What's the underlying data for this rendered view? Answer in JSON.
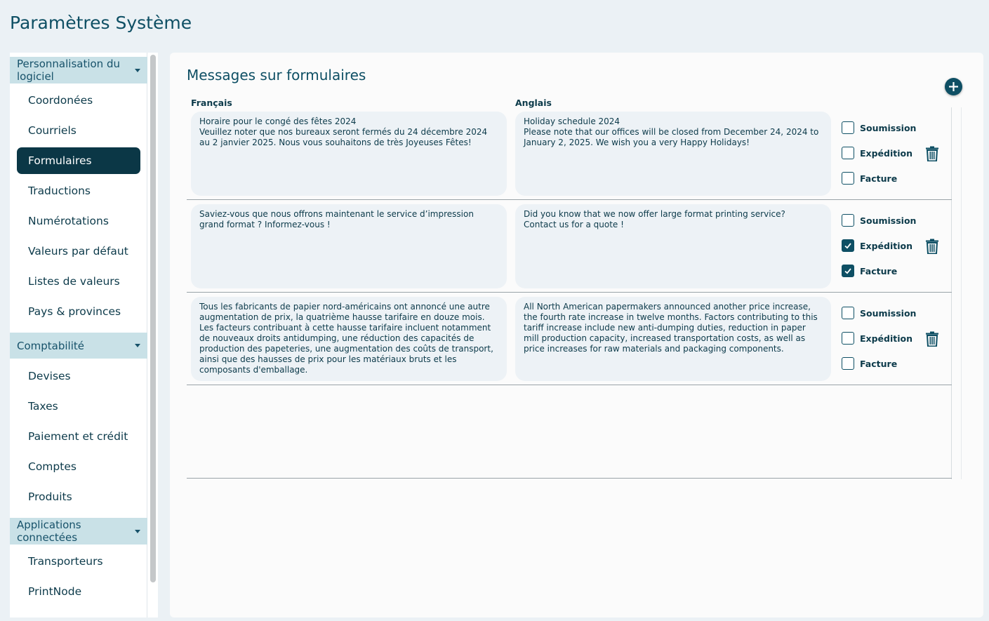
{
  "page": {
    "title": "Paramètres Système"
  },
  "sidebar": {
    "sections": [
      {
        "label": "Personnalisation du logiciel",
        "items": [
          "Coordonées",
          "Courriels",
          "Formulaires",
          "Traductions",
          "Numérotations",
          "Valeurs par défaut",
          "Listes de valeurs",
          "Pays & provinces"
        ]
      },
      {
        "label": "Comptabilité",
        "items": [
          "Devises",
          "Taxes",
          "Paiement et crédit",
          "Comptes",
          "Produits"
        ]
      },
      {
        "label": "Applications connectées",
        "items": [
          "Transporteurs",
          "PrintNode"
        ]
      }
    ],
    "active_item": "Formulaires"
  },
  "main": {
    "title": "Messages sur formulaires",
    "col_fr": "Français",
    "col_en": "Anglais",
    "option_labels": {
      "submission": "Soumission",
      "shipping": "Expédition",
      "invoice": "Facture"
    },
    "messages": [
      {
        "fr": "Horaire pour le congé des fêtes 2024\nVeuillez noter que nos bureaux seront fermés du 24 décembre 2024 au 2 janvier 2025. Nous vous souhaitons de très Joyeuses Fêtes!",
        "en": "Holiday schedule 2024\nPlease note that our offices will be closed from December 24, 2024 to January 2, 2025. We wish you a very Happy Holidays!",
        "submission": false,
        "shipping": false,
        "invoice": false
      },
      {
        "fr": "Saviez-vous que nous offrons maintenant le service d’impression grand format ? Informez-vous !",
        "en": "Did you know that we now offer large format printing service?\nContact us for a quote !",
        "submission": false,
        "shipping": true,
        "invoice": true
      },
      {
        "fr": "Tous les fabricants de papier nord-américains ont annoncé une autre augmentation de prix, la quatrième hausse tarifaire en douze mois. Les facteurs contribuant à cette hausse tarifaire incluent notamment de nouveaux droits antidumping, une réduction des capacités de production des papeteries, une augmentation des coûts de transport, ainsi que des hausses de prix pour les matériaux bruts et les composants d'emballage.",
        "en": "All North American papermakers announced another price increase, the fourth rate increase in twelve months. Factors contributing to this tariff increase include new anti-dumping duties, reduction in paper mill production capacity, increased transportation costs, as well as price increases for raw materials and packaging components.",
        "submission": false,
        "shipping": false,
        "invoice": false
      }
    ]
  },
  "colors": {
    "accent": "#0e4f64",
    "active_nav": "#0b3746",
    "section_bg": "#c9e1e7",
    "message_bg": "#edf2f6"
  }
}
